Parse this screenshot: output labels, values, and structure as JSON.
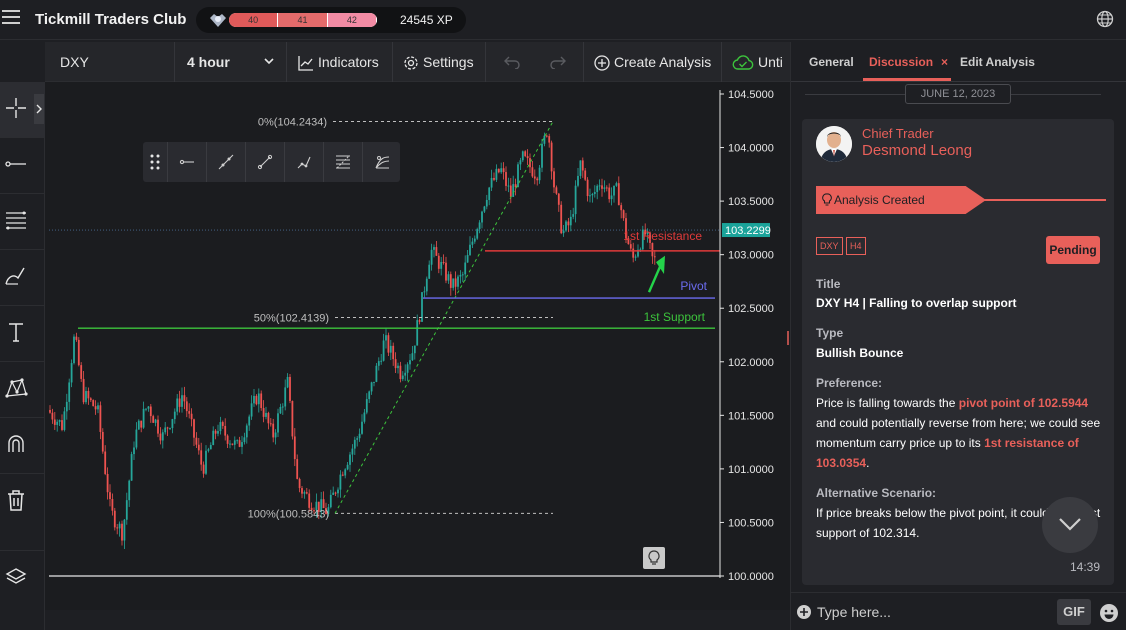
{
  "app": {
    "title": "Tickmill Traders Club",
    "xp_levels": [
      "40",
      "41",
      "42"
    ],
    "xp_level_progress": [
      1.0,
      1.0,
      0.8
    ],
    "xp_text": "24545 XP"
  },
  "toolbar": {
    "symbol": "DXY",
    "interval": "4 hour",
    "indicators_label": "Indicators",
    "settings_label": "Settings",
    "create_label": "Create Analysis",
    "until_label": "Unti"
  },
  "chart": {
    "price_labels": [
      "104.5000",
      "104.0000",
      "103.5000",
      "103.0000",
      "102.5000",
      "102.0000",
      "101.5000",
      "101.0000",
      "100.5000",
      "100.0000"
    ],
    "current_price": "103.2299",
    "fib_labels": {
      "f0": "0%(104.2434)",
      "f50": "50%(102.4139)",
      "f100": "100%(100.5843)"
    },
    "levels": {
      "resistance": "1st Resistance",
      "pivot": "Pivot",
      "support": "1st Support"
    },
    "colors": {
      "up": "#26a69a",
      "down": "#ef5350",
      "resistance": "#e03a3a",
      "pivot": "#6c6cf0",
      "support": "#3cc43c",
      "arrow": "#24d34a"
    }
  },
  "panel": {
    "tabs": {
      "general": "General",
      "discussion": "Discussion",
      "edit": "Edit Analysis"
    },
    "date": "JUNE 12, 2023",
    "post": {
      "role": "Chief Trader",
      "author": "Desmond Leong",
      "event": "Analysis Created",
      "tags": [
        "DXY",
        "H4"
      ],
      "status": "Pending",
      "title_label": "Title",
      "title": "DXY H4 | Falling to overlap support",
      "type_label": "Type",
      "type": "Bullish Bounce",
      "preference_label": "Preference:",
      "pref_text_1": "Price is falling towards the ",
      "pref_hl_1": "pivot point of 102.5944",
      "pref_text_2": " and could potentially reverse from here; we could see momentum carry price up to its ",
      "pref_hl_2": "1st resistance of 103.0354",
      "pref_text_3": ".",
      "alt_label": "Alternative Scenario:",
      "alt_text": "If price breaks below the pivot point, it could fall to 1st support of 102.314.",
      "time": "14:39"
    },
    "input_placeholder": "Type here...",
    "gif_label": "GIF"
  }
}
